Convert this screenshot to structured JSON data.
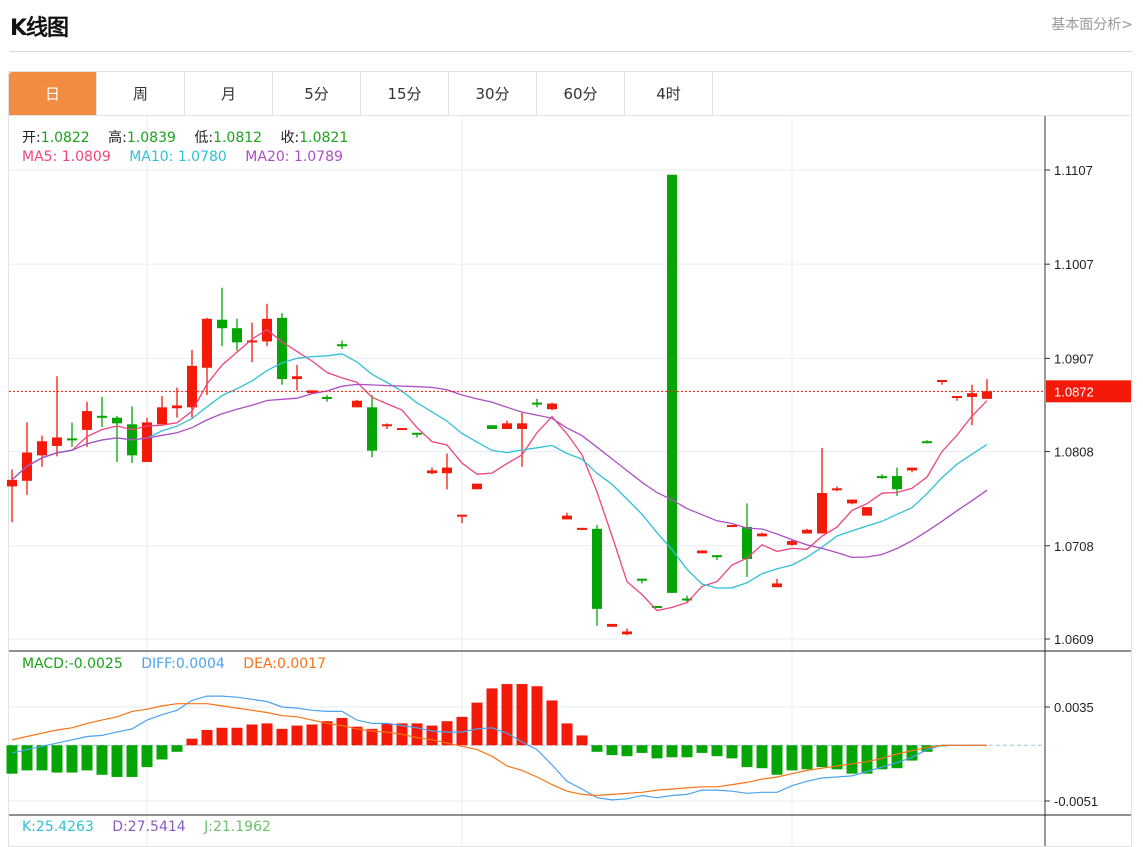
{
  "header": {
    "title": "K线图",
    "link": "基本面分析>"
  },
  "tabs": [
    {
      "label": "日",
      "active": true
    },
    {
      "label": "周"
    },
    {
      "label": "月"
    },
    {
      "label": "5分"
    },
    {
      "label": "15分"
    },
    {
      "label": "30分"
    },
    {
      "label": "60分"
    },
    {
      "label": "4时"
    }
  ],
  "legend": {
    "open_label": "开:",
    "open": "1.0822",
    "high_label": "高:",
    "high": "1.0839",
    "low_label": "低:",
    "low": "1.0812",
    "close_label": "收:",
    "close": "1.0821",
    "ma5_label": "MA5:",
    "ma5": "1.0809",
    "ma10_label": "MA10:",
    "ma10": "1.0780",
    "ma20_label": "MA20:",
    "ma20": "1.0789"
  },
  "macd_legend": {
    "macd_label": "MACD:",
    "macd": "-0.0025",
    "diff_label": "DIFF:",
    "diff": "0.0004",
    "dea_label": "DEA:",
    "dea": "0.0017"
  },
  "kdj_legend": {
    "k_label": "K:",
    "k": "25.4263",
    "d_label": "D:",
    "d": "27.5414",
    "j_label": "J:",
    "j": "21.1962"
  },
  "colors": {
    "up": "#f31a0a",
    "down": "#05a505",
    "ma5": "#f0457a",
    "ma10": "#30c0d8",
    "ma20": "#ad4fc4",
    "diff": "#4ba3f0",
    "dea": "#f97316",
    "accent": "#F28C3F"
  },
  "chart_data": [
    {
      "type": "candlestick",
      "title": "K线图",
      "candle_fields": [
        "open",
        "high",
        "low",
        "close"
      ],
      "candles": [
        [
          1.0771,
          1.0789,
          1.0733,
          1.0778
        ],
        [
          1.0777,
          1.0839,
          1.0762,
          1.0807
        ],
        [
          1.0804,
          1.0825,
          1.0792,
          1.0819
        ],
        [
          1.0814,
          1.0888,
          1.0803,
          1.0823
        ],
        [
          1.0822,
          1.0839,
          1.0813,
          1.082
        ],
        [
          1.0831,
          1.0861,
          1.0813,
          1.0851
        ],
        [
          1.0846,
          1.0866,
          1.0834,
          1.0844
        ],
        [
          1.0844,
          1.0846,
          1.0797,
          1.0838
        ],
        [
          1.0837,
          1.0856,
          1.0796,
          1.0804
        ],
        [
          1.0797,
          1.0844,
          1.0797,
          1.0839
        ],
        [
          1.0837,
          1.0867,
          1.0837,
          1.0855
        ],
        [
          1.0854,
          1.0876,
          1.0844,
          1.0857
        ],
        [
          1.0855,
          1.0916,
          1.0844,
          1.0899
        ],
        [
          1.0897,
          1.095,
          1.0868,
          1.0949
        ],
        [
          1.0948,
          1.0982,
          1.092,
          1.0939
        ],
        [
          1.0939,
          1.0949,
          1.0915,
          1.0924
        ],
        [
          1.0924,
          1.0945,
          1.0903,
          1.0926
        ],
        [
          1.0925,
          1.0965,
          1.092,
          1.0949
        ],
        [
          1.095,
          1.0955,
          1.0879,
          1.0885
        ],
        [
          1.0885,
          1.09,
          1.0873,
          1.0888
        ],
        [
          1.087,
          1.0873,
          1.087,
          1.0873
        ],
        [
          1.0866,
          1.0868,
          1.0861,
          1.0865
        ],
        [
          1.0922,
          1.0926,
          1.0917,
          1.092
        ],
        [
          1.0855,
          1.0863,
          1.0855,
          1.0862
        ],
        [
          1.0855,
          1.0868,
          1.0802,
          1.0809
        ],
        [
          1.0835,
          1.0838,
          1.0832,
          1.0837
        ],
        [
          1.0831,
          1.0833,
          1.0831,
          1.0833
        ],
        [
          1.0828,
          1.0828,
          1.0823,
          1.0826
        ],
        [
          1.0785,
          1.0791,
          1.0784,
          1.0788
        ],
        [
          1.0785,
          1.0806,
          1.0768,
          1.0791
        ],
        [
          1.074,
          1.0741,
          1.0732,
          1.0741
        ],
        [
          1.0768,
          1.0774,
          1.0768,
          1.0774
        ],
        [
          1.0836,
          1.0836,
          1.0832,
          1.0832
        ],
        [
          1.0832,
          1.0841,
          1.0832,
          1.0838
        ],
        [
          1.0832,
          1.0849,
          1.0792,
          1.0838
        ],
        [
          1.086,
          1.0864,
          1.0855,
          1.0859
        ],
        [
          1.0853,
          1.086,
          1.0852,
          1.0859
        ],
        [
          1.0736,
          1.0743,
          1.0736,
          1.074
        ],
        [
          1.0725,
          1.0727,
          1.0725,
          1.0727
        ],
        [
          1.0726,
          1.073,
          1.0623,
          1.0641
        ],
        [
          1.0622,
          1.0625,
          1.0622,
          1.0625
        ],
        [
          1.0614,
          1.062,
          1.0613,
          1.0617
        ],
        [
          1.0673,
          1.0673,
          1.0668,
          1.0671
        ],
        [
          1.0644,
          1.0644,
          1.0642,
          1.0642
        ],
        [
          1.1102,
          1.1102,
          1.0658,
          1.0658
        ],
        [
          1.0652,
          1.0655,
          1.0648,
          1.065
        ],
        [
          1.07,
          1.0703,
          1.07,
          1.0703
        ],
        [
          1.0698,
          1.0698,
          1.0693,
          1.0697
        ],
        [
          1.0728,
          1.073,
          1.0728,
          1.073
        ],
        [
          1.0728,
          1.0753,
          1.0675,
          1.0694
        ],
        [
          1.0718,
          1.0722,
          1.0718,
          1.0721
        ],
        [
          1.0664,
          1.0673,
          1.0664,
          1.0668
        ],
        [
          1.0709,
          1.0715,
          1.0708,
          1.0713
        ],
        [
          1.0721,
          1.0726,
          1.0721,
          1.0725
        ],
        [
          1.0721,
          1.0812,
          1.0721,
          1.0764
        ],
        [
          1.0767,
          1.0771,
          1.0766,
          1.0769
        ],
        [
          1.0753,
          1.0757,
          1.0752,
          1.0757
        ],
        [
          1.074,
          1.0749,
          1.074,
          1.0749
        ],
        [
          1.0782,
          1.0784,
          1.0779,
          1.078
        ],
        [
          1.0782,
          1.0791,
          1.0761,
          1.0768
        ],
        [
          1.0788,
          1.0791,
          1.0786,
          1.0791
        ],
        [
          1.0819,
          1.082,
          1.0817,
          1.0817
        ],
        [
          1.0883,
          1.0884,
          1.0879,
          1.0884
        ],
        [
          1.0866,
          1.0867,
          1.0862,
          1.0867
        ],
        [
          1.0866,
          1.0879,
          1.0836,
          1.087
        ],
        [
          1.0864,
          1.0885,
          1.0864,
          1.0872
        ]
      ],
      "ma_periods": [
        5,
        10,
        20
      ],
      "y_ticks": [
        "1.1107",
        "1.1007",
        "1.0907",
        "1.0808",
        "1.0708",
        "1.0609"
      ],
      "ylim": [
        1.0609,
        1.1107
      ],
      "current_price": "1.0872",
      "grid": true
    },
    {
      "type": "macd",
      "macd": [
        -0.0026,
        -0.0023,
        -0.0023,
        -0.0025,
        -0.0025,
        -0.0023,
        -0.0027,
        -0.0029,
        -0.0029,
        -0.002,
        -0.0013,
        -0.0006,
        0.0006,
        0.0014,
        0.0016,
        0.0016,
        0.0019,
        0.002,
        0.0015,
        0.0018,
        0.0019,
        0.0022,
        0.0025,
        0.0017,
        0.0015,
        0.002,
        0.002,
        0.002,
        0.0018,
        0.0022,
        0.0026,
        0.0039,
        0.0052,
        0.0056,
        0.0056,
        0.0054,
        0.0041,
        0.002,
        0.0009,
        -0.0006,
        -0.0009,
        -0.001,
        -0.0007,
        -0.0012,
        -0.0011,
        -0.0011,
        -0.0007,
        -0.001,
        -0.0012,
        -0.002,
        -0.0021,
        -0.0027,
        -0.0023,
        -0.0022,
        -0.002,
        -0.0022,
        -0.0026,
        -0.0026,
        -0.0022,
        -0.0021,
        -0.0014,
        -0.0006,
        -0.0001,
        0.0,
        0.0,
        0.0
      ],
      "diff": [
        -0.0007,
        -0.0004,
        -0.0001,
        0.0002,
        0.0005,
        0.0008,
        0.0009,
        0.0012,
        0.0015,
        0.0023,
        0.0028,
        0.0032,
        0.0041,
        0.0045,
        0.0045,
        0.0044,
        0.0042,
        0.004,
        0.0035,
        0.0034,
        0.0032,
        0.0031,
        0.0031,
        0.0023,
        0.002,
        0.002,
        0.0018,
        0.0016,
        0.0013,
        0.0012,
        0.0012,
        0.0015,
        0.0016,
        0.0011,
        0.0003,
        -0.0004,
        -0.0018,
        -0.0033,
        -0.004,
        -0.0048,
        -0.005,
        -0.0049,
        -0.0046,
        -0.0048,
        -0.0046,
        -0.0045,
        -0.0041,
        -0.0041,
        -0.0042,
        -0.0044,
        -0.0043,
        -0.0043,
        -0.0037,
        -0.0033,
        -0.003,
        -0.0029,
        -0.0028,
        -0.0024,
        -0.002,
        -0.0016,
        -0.0011,
        -0.0004,
        0.0,
        0.0,
        0.0,
        0.0
      ],
      "dea": [
        0.0005,
        0.0008,
        0.0011,
        0.0014,
        0.0016,
        0.002,
        0.0023,
        0.0026,
        0.0031,
        0.0033,
        0.0036,
        0.0038,
        0.0038,
        0.0038,
        0.0036,
        0.0034,
        0.0032,
        0.003,
        0.0027,
        0.0026,
        0.0023,
        0.002,
        0.0018,
        0.0015,
        0.0013,
        0.0012,
        0.001,
        0.0007,
        0.0005,
        0.0002,
        -0.0001,
        -0.0004,
        -0.001,
        -0.0019,
        -0.0023,
        -0.0029,
        -0.0036,
        -0.0042,
        -0.0045,
        -0.0046,
        -0.0045,
        -0.0044,
        -0.0043,
        -0.0041,
        -0.004,
        -0.0039,
        -0.0038,
        -0.0038,
        -0.0036,
        -0.0034,
        -0.0031,
        -0.0029,
        -0.0026,
        -0.0023,
        -0.0021,
        -0.0019,
        -0.0017,
        -0.0015,
        -0.0012,
        -0.0008,
        -0.0005,
        -0.0002,
        0.0,
        0.0,
        0.0,
        0.0
      ],
      "y_ticks": [
        "0.0035",
        "-0.0051"
      ],
      "ylim": [
        -0.0051,
        0.0035
      ]
    }
  ]
}
